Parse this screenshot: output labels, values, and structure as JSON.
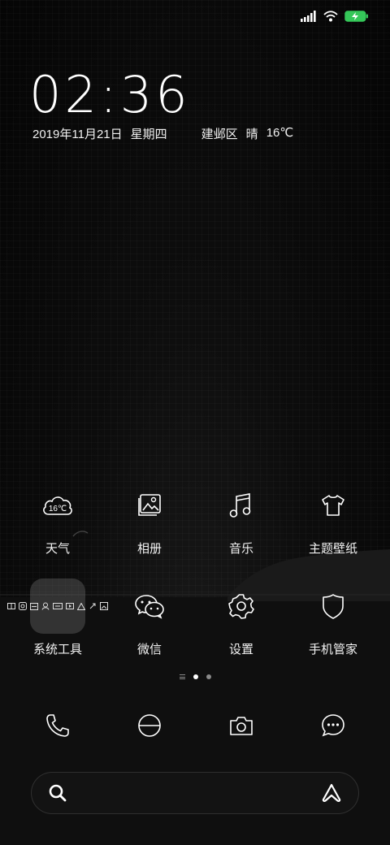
{
  "clock": {
    "time": "02:36"
  },
  "info": {
    "date": "2019年11月21日",
    "weekday": "星期四",
    "location": "建邺区",
    "weather": "晴",
    "temperature": "16℃"
  },
  "status_bar": {
    "signal_icon": "signal-icon",
    "wifi_icon": "wifi-icon",
    "battery_icon": "battery-charging-icon",
    "battery_color": "#35c759"
  },
  "apps_row1": [
    {
      "label": "天气",
      "icon": "weather-cloud-icon",
      "icon_text": "16℃"
    },
    {
      "label": "相册",
      "icon": "gallery-icon"
    },
    {
      "label": "音乐",
      "icon": "music-icon"
    },
    {
      "label": "主题壁纸",
      "icon": "theme-shirt-icon"
    }
  ],
  "apps_row2": [
    {
      "label": "系统工具",
      "icon": "folder-icon"
    },
    {
      "label": "微信",
      "icon": "wechat-icon"
    },
    {
      "label": "设置",
      "icon": "settings-gear-icon"
    },
    {
      "label": "手机管家",
      "icon": "security-shield-icon"
    }
  ],
  "page_indicator": {
    "pages": 2,
    "active": 0
  },
  "dock": [
    {
      "icon": "phone-icon"
    },
    {
      "icon": "browser-icon"
    },
    {
      "icon": "camera-icon"
    },
    {
      "icon": "messages-icon"
    }
  ],
  "search_bar": {
    "search_icon": "search-icon",
    "assistant_icon": "assistant-icon"
  }
}
